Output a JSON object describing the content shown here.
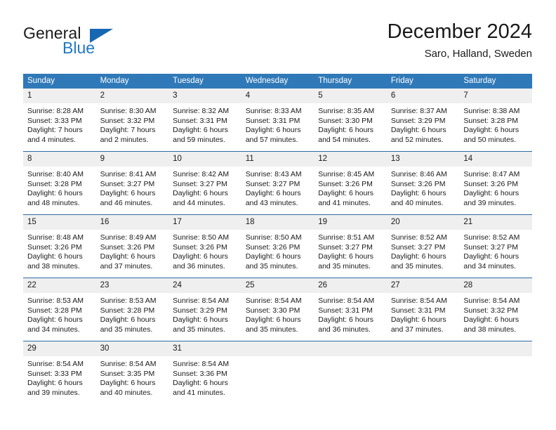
{
  "brand": {
    "name_part1": "General",
    "name_part2": "Blue",
    "triangle_icon": "blue-triangle-logo-mark",
    "accent_color": "#1668b3"
  },
  "header": {
    "title": "December 2024",
    "subtitle": "Saro, Halland, Sweden"
  },
  "calendar": {
    "header_bg": "#3079b8",
    "daynum_bg": "#efefef",
    "rule_color": "#2f6ca8",
    "weekdays": [
      "Sunday",
      "Monday",
      "Tuesday",
      "Wednesday",
      "Thursday",
      "Friday",
      "Saturday"
    ],
    "labels": {
      "sunrise": "Sunrise:",
      "sunset": "Sunset:",
      "daylight": "Daylight:"
    },
    "weeks": [
      [
        {
          "day": "1",
          "sunrise": "Sunrise: 8:28 AM",
          "sunset": "Sunset: 3:33 PM",
          "daylight_line1": "Daylight: 7 hours",
          "daylight_line2": "and 4 minutes."
        },
        {
          "day": "2",
          "sunrise": "Sunrise: 8:30 AM",
          "sunset": "Sunset: 3:32 PM",
          "daylight_line1": "Daylight: 7 hours",
          "daylight_line2": "and 2 minutes."
        },
        {
          "day": "3",
          "sunrise": "Sunrise: 8:32 AM",
          "sunset": "Sunset: 3:31 PM",
          "daylight_line1": "Daylight: 6 hours",
          "daylight_line2": "and 59 minutes."
        },
        {
          "day": "4",
          "sunrise": "Sunrise: 8:33 AM",
          "sunset": "Sunset: 3:31 PM",
          "daylight_line1": "Daylight: 6 hours",
          "daylight_line2": "and 57 minutes."
        },
        {
          "day": "5",
          "sunrise": "Sunrise: 8:35 AM",
          "sunset": "Sunset: 3:30 PM",
          "daylight_line1": "Daylight: 6 hours",
          "daylight_line2": "and 54 minutes."
        },
        {
          "day": "6",
          "sunrise": "Sunrise: 8:37 AM",
          "sunset": "Sunset: 3:29 PM",
          "daylight_line1": "Daylight: 6 hours",
          "daylight_line2": "and 52 minutes."
        },
        {
          "day": "7",
          "sunrise": "Sunrise: 8:38 AM",
          "sunset": "Sunset: 3:28 PM",
          "daylight_line1": "Daylight: 6 hours",
          "daylight_line2": "and 50 minutes."
        }
      ],
      [
        {
          "day": "8",
          "sunrise": "Sunrise: 8:40 AM",
          "sunset": "Sunset: 3:28 PM",
          "daylight_line1": "Daylight: 6 hours",
          "daylight_line2": "and 48 minutes."
        },
        {
          "day": "9",
          "sunrise": "Sunrise: 8:41 AM",
          "sunset": "Sunset: 3:27 PM",
          "daylight_line1": "Daylight: 6 hours",
          "daylight_line2": "and 46 minutes."
        },
        {
          "day": "10",
          "sunrise": "Sunrise: 8:42 AM",
          "sunset": "Sunset: 3:27 PM",
          "daylight_line1": "Daylight: 6 hours",
          "daylight_line2": "and 44 minutes."
        },
        {
          "day": "11",
          "sunrise": "Sunrise: 8:43 AM",
          "sunset": "Sunset: 3:27 PM",
          "daylight_line1": "Daylight: 6 hours",
          "daylight_line2": "and 43 minutes."
        },
        {
          "day": "12",
          "sunrise": "Sunrise: 8:45 AM",
          "sunset": "Sunset: 3:26 PM",
          "daylight_line1": "Daylight: 6 hours",
          "daylight_line2": "and 41 minutes."
        },
        {
          "day": "13",
          "sunrise": "Sunrise: 8:46 AM",
          "sunset": "Sunset: 3:26 PM",
          "daylight_line1": "Daylight: 6 hours",
          "daylight_line2": "and 40 minutes."
        },
        {
          "day": "14",
          "sunrise": "Sunrise: 8:47 AM",
          "sunset": "Sunset: 3:26 PM",
          "daylight_line1": "Daylight: 6 hours",
          "daylight_line2": "and 39 minutes."
        }
      ],
      [
        {
          "day": "15",
          "sunrise": "Sunrise: 8:48 AM",
          "sunset": "Sunset: 3:26 PM",
          "daylight_line1": "Daylight: 6 hours",
          "daylight_line2": "and 38 minutes."
        },
        {
          "day": "16",
          "sunrise": "Sunrise: 8:49 AM",
          "sunset": "Sunset: 3:26 PM",
          "daylight_line1": "Daylight: 6 hours",
          "daylight_line2": "and 37 minutes."
        },
        {
          "day": "17",
          "sunrise": "Sunrise: 8:50 AM",
          "sunset": "Sunset: 3:26 PM",
          "daylight_line1": "Daylight: 6 hours",
          "daylight_line2": "and 36 minutes."
        },
        {
          "day": "18",
          "sunrise": "Sunrise: 8:50 AM",
          "sunset": "Sunset: 3:26 PM",
          "daylight_line1": "Daylight: 6 hours",
          "daylight_line2": "and 35 minutes."
        },
        {
          "day": "19",
          "sunrise": "Sunrise: 8:51 AM",
          "sunset": "Sunset: 3:27 PM",
          "daylight_line1": "Daylight: 6 hours",
          "daylight_line2": "and 35 minutes."
        },
        {
          "day": "20",
          "sunrise": "Sunrise: 8:52 AM",
          "sunset": "Sunset: 3:27 PM",
          "daylight_line1": "Daylight: 6 hours",
          "daylight_line2": "and 35 minutes."
        },
        {
          "day": "21",
          "sunrise": "Sunrise: 8:52 AM",
          "sunset": "Sunset: 3:27 PM",
          "daylight_line1": "Daylight: 6 hours",
          "daylight_line2": "and 34 minutes."
        }
      ],
      [
        {
          "day": "22",
          "sunrise": "Sunrise: 8:53 AM",
          "sunset": "Sunset: 3:28 PM",
          "daylight_line1": "Daylight: 6 hours",
          "daylight_line2": "and 34 minutes."
        },
        {
          "day": "23",
          "sunrise": "Sunrise: 8:53 AM",
          "sunset": "Sunset: 3:28 PM",
          "daylight_line1": "Daylight: 6 hours",
          "daylight_line2": "and 35 minutes."
        },
        {
          "day": "24",
          "sunrise": "Sunrise: 8:54 AM",
          "sunset": "Sunset: 3:29 PM",
          "daylight_line1": "Daylight: 6 hours",
          "daylight_line2": "and 35 minutes."
        },
        {
          "day": "25",
          "sunrise": "Sunrise: 8:54 AM",
          "sunset": "Sunset: 3:30 PM",
          "daylight_line1": "Daylight: 6 hours",
          "daylight_line2": "and 35 minutes."
        },
        {
          "day": "26",
          "sunrise": "Sunrise: 8:54 AM",
          "sunset": "Sunset: 3:31 PM",
          "daylight_line1": "Daylight: 6 hours",
          "daylight_line2": "and 36 minutes."
        },
        {
          "day": "27",
          "sunrise": "Sunrise: 8:54 AM",
          "sunset": "Sunset: 3:31 PM",
          "daylight_line1": "Daylight: 6 hours",
          "daylight_line2": "and 37 minutes."
        },
        {
          "day": "28",
          "sunrise": "Sunrise: 8:54 AM",
          "sunset": "Sunset: 3:32 PM",
          "daylight_line1": "Daylight: 6 hours",
          "daylight_line2": "and 38 minutes."
        }
      ],
      [
        {
          "day": "29",
          "sunrise": "Sunrise: 8:54 AM",
          "sunset": "Sunset: 3:33 PM",
          "daylight_line1": "Daylight: 6 hours",
          "daylight_line2": "and 39 minutes."
        },
        {
          "day": "30",
          "sunrise": "Sunrise: 8:54 AM",
          "sunset": "Sunset: 3:35 PM",
          "daylight_line1": "Daylight: 6 hours",
          "daylight_line2": "and 40 minutes."
        },
        {
          "day": "31",
          "sunrise": "Sunrise: 8:54 AM",
          "sunset": "Sunset: 3:36 PM",
          "daylight_line1": "Daylight: 6 hours",
          "daylight_line2": "and 41 minutes."
        },
        {
          "day": "",
          "sunrise": "",
          "sunset": "",
          "daylight_line1": "",
          "daylight_line2": ""
        },
        {
          "day": "",
          "sunrise": "",
          "sunset": "",
          "daylight_line1": "",
          "daylight_line2": ""
        },
        {
          "day": "",
          "sunrise": "",
          "sunset": "",
          "daylight_line1": "",
          "daylight_line2": ""
        },
        {
          "day": "",
          "sunrise": "",
          "sunset": "",
          "daylight_line1": "",
          "daylight_line2": ""
        }
      ]
    ]
  }
}
